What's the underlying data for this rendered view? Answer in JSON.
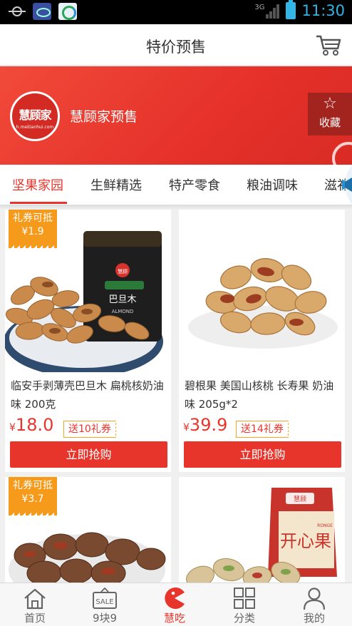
{
  "status_bar": {
    "network": "3G",
    "time": "11:30"
  },
  "header": {
    "title": "特价预售"
  },
  "store": {
    "logo_text": "慧顾家",
    "logo_sub": "h.meitianhui.com",
    "name": "慧顾家预售",
    "favorite_label": "收藏"
  },
  "tabs": [
    {
      "label": "坚果家园",
      "active": true
    },
    {
      "label": "生鲜精选",
      "active": false
    },
    {
      "label": "特产零食",
      "active": false
    },
    {
      "label": "粮油调味",
      "active": false
    },
    {
      "label": "滋补",
      "active": false
    }
  ],
  "products": [
    {
      "badge_line1": "礼券可抵",
      "badge_line2": "¥1.9",
      "jar_brand": "慧顾",
      "jar_label": "巴旦木",
      "jar_en": "ALMOND",
      "name": "临安手剥薄壳巴旦木 扁桃核奶油味 200克",
      "currency": "¥",
      "price": "18.0",
      "gift": "送10礼券",
      "buy_label": "立即抢购"
    },
    {
      "name": "碧根果 美国山核桃 长寿果 奶油味 205g*2",
      "currency": "¥",
      "price": "39.9",
      "gift": "送14礼券",
      "buy_label": "立即抢购"
    },
    {
      "badge_line1": "礼券可抵",
      "badge_line2": "¥3.7"
    },
    {
      "bag_brand": "慧顾",
      "bag_label": "开心果",
      "bag_side": "RONGE"
    }
  ],
  "bottom_nav": [
    {
      "label": "首页",
      "icon": "home-icon",
      "active": false
    },
    {
      "label": "9块9",
      "icon": "sale-tag-icon",
      "icon_text": "SALE",
      "active": false
    },
    {
      "label": "慧吃",
      "icon": "pacman-icon",
      "active": true
    },
    {
      "label": "分类",
      "icon": "grid-icon",
      "active": false
    },
    {
      "label": "我的",
      "icon": "user-icon",
      "active": false
    }
  ],
  "colors": {
    "accent": "#e8352c",
    "badge": "#f59a1a",
    "status_time": "#33b5e5",
    "favorite_bg": "#a3231e"
  }
}
